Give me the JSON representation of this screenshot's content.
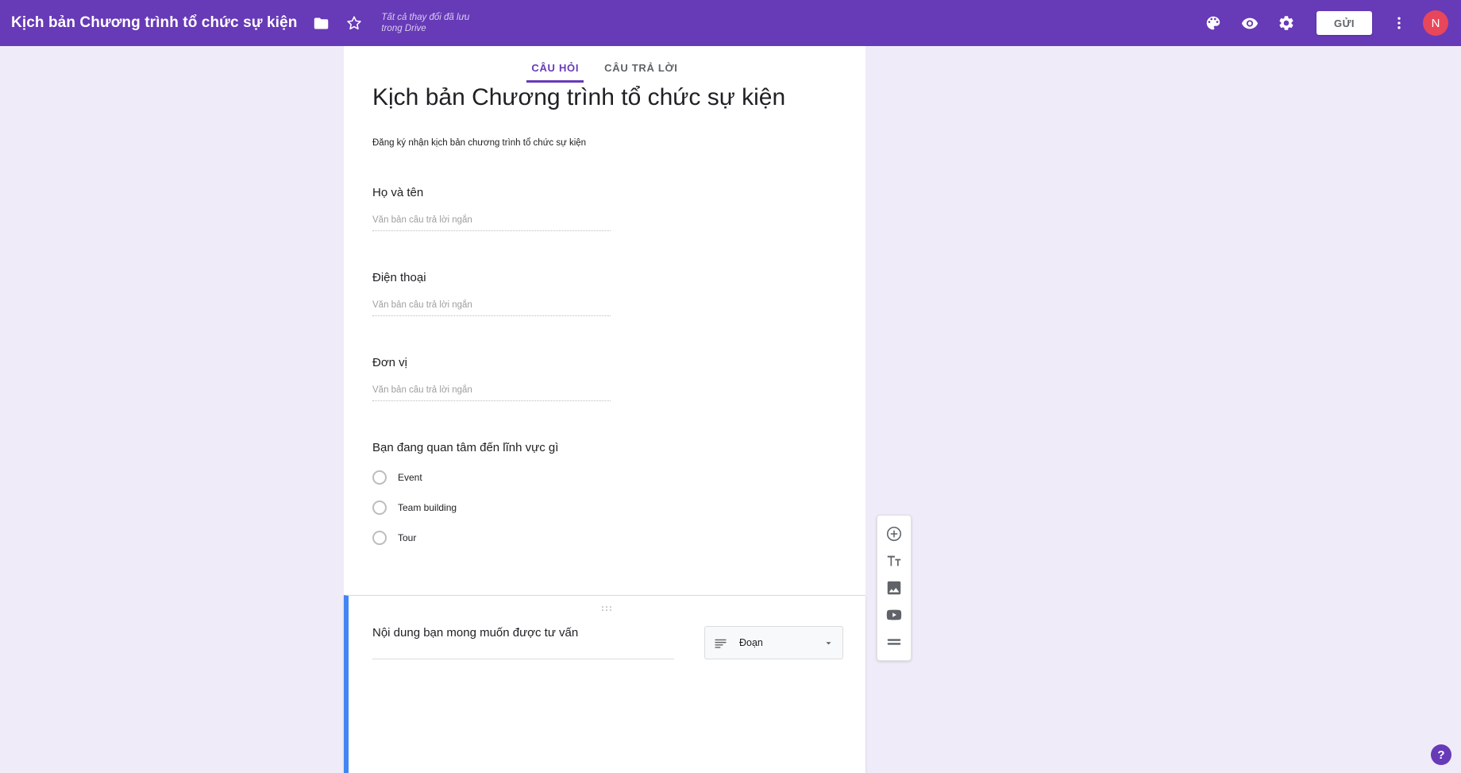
{
  "topbar": {
    "doc_title": "Kịch bản Chương trình tổ chức sự kiện",
    "folder_icon": "folder-icon",
    "star_icon": "star-icon",
    "save_status": "Tất cả thay đổi đã lưu trong Drive",
    "palette_icon": "palette-icon",
    "preview_icon": "eye-icon",
    "settings_icon": "gear-icon",
    "send_label": "GỬI",
    "more_icon": "more-vert-icon",
    "avatar_initial": "N",
    "bar_color": "#673ab7",
    "avatar_color": "#e8465b"
  },
  "tabs": [
    {
      "label": "CÂU HỎI",
      "active": true
    },
    {
      "label": "CÂU TRẢ LỜI",
      "active": false
    }
  ],
  "form": {
    "title": "Kịch bản Chương trình tổ chức sự kiện",
    "description": "Đăng ký nhận kịch bản chương trình tổ chức sự kiện",
    "short_answer_placeholder": "Văn bản câu trả lời ngắn",
    "questions": [
      {
        "title": "Họ và tên",
        "type": "short_answer"
      },
      {
        "title": "Điện thoại",
        "type": "short_answer"
      },
      {
        "title": "Đơn vị",
        "type": "short_answer"
      },
      {
        "title": "Bạn đang quan tâm đến lĩnh vực gì",
        "type": "radio",
        "options": [
          "Event",
          "Team building",
          "Tour"
        ]
      }
    ],
    "active_question": {
      "title": "Nội dung bạn mong muốn được tư vấn",
      "type_label": "Đoạn",
      "type_icon": "paragraph-lines-icon",
      "dropdown_icon": "chevron-down-icon",
      "accent_color": "#4285f4"
    }
  },
  "toolbar": {
    "add_question": "add-circle-icon",
    "import_title": "title-text-icon",
    "add_image": "image-icon",
    "add_video": "video-icon",
    "add_section": "section-icon"
  },
  "help": {
    "label": "?"
  }
}
